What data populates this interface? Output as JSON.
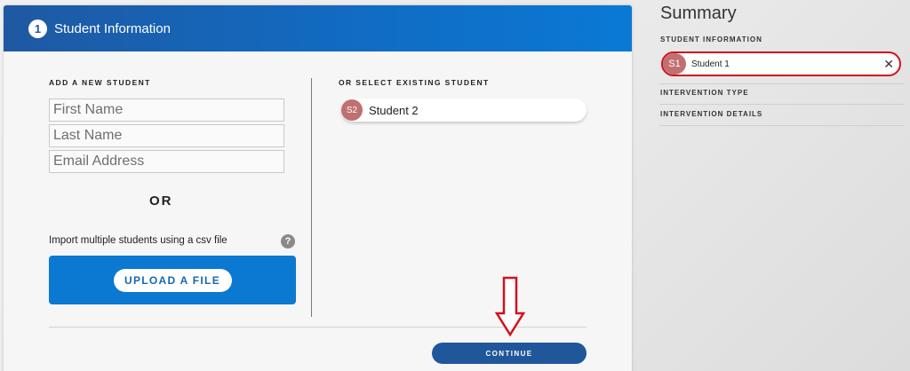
{
  "card": {
    "step_number": "1",
    "title": "Student Information"
  },
  "add_student": {
    "heading": "ADD A NEW STUDENT",
    "first_name_placeholder": "First Name",
    "last_name_placeholder": "Last Name",
    "email_placeholder": "Email Address",
    "or_label": "OR",
    "import_label": "Import multiple students using a csv file",
    "help_glyph": "?",
    "upload_label": "UPLOAD A FILE"
  },
  "existing": {
    "heading": "OR SELECT EXISTING STUDENT",
    "students": [
      {
        "initials": "S2",
        "name": "Student 2"
      }
    ]
  },
  "continue_label": "CONTINUE",
  "summary": {
    "title": "Summary",
    "student_information_label": "STUDENT INFORMATION",
    "selected_student": {
      "initials": "S1",
      "name": "Student 1",
      "remove_glyph": "✕"
    },
    "intervention_type_label": "INTERVENTION TYPE",
    "intervention_details_label": "INTERVENTION DETAILS"
  },
  "colors": {
    "header_blue": "#1368bd",
    "upload_blue": "#0b78d2",
    "continue_blue": "#20579b",
    "avatar": "#c07070",
    "highlight_red": "#d0121c"
  },
  "icons": {
    "help": "help-icon",
    "remove": "close-icon",
    "annotation": "down-arrow-icon"
  }
}
